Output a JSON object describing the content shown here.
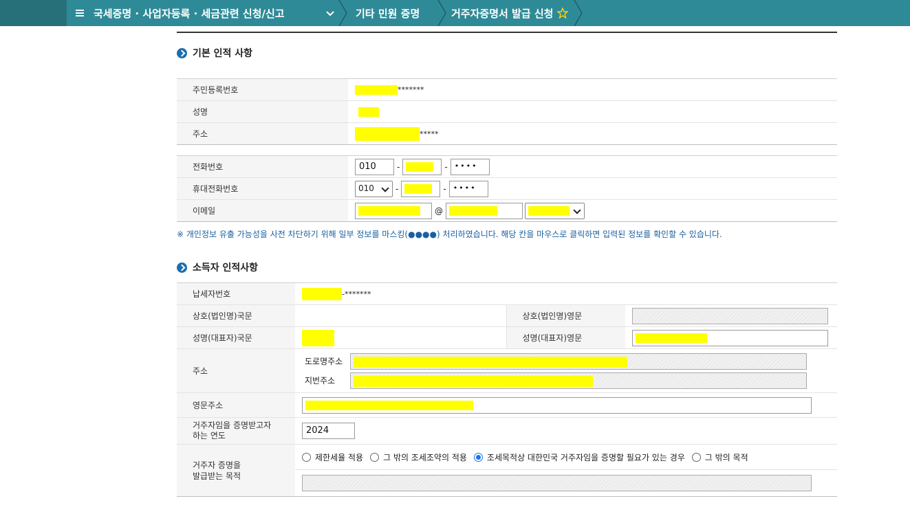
{
  "header": {
    "main_crumb": "국세증명 · 사업자등록 · 세금관련 신청/신고",
    "crumb_2": "기타 민원 증명",
    "crumb_3": "거주자증명서 발급 신청",
    "icons": [
      "menu-icon",
      "chevron-down-icon",
      "star-icon"
    ]
  },
  "basic_section": {
    "title": "기본 인적 사항",
    "rows": {
      "rrn_label": "주민등록번호",
      "rrn_suffix": "*******",
      "name_label": "성명",
      "address_label": "주소",
      "address_suffix": "*****"
    },
    "contact": {
      "phone_label": "전화번호",
      "phone_first": "010",
      "phone_last": "••••",
      "mobile_label": "휴대전화번호",
      "mobile_first": "010",
      "mobile_last": "••••",
      "email_label": "이메일",
      "email_at": "@"
    }
  },
  "notice": "※ 개인정보 유출 가능성을 사전 차단하기 위해 일부 정보를 마스킹(●●●●) 처리하였습니다. 해당 칸을 마우스로 클릭하면 입력된 정보를 확인할 수 있습니다.",
  "income_section": {
    "title": "소득자 인적사항",
    "tin_label": "납세자번호",
    "tin_suffix": "-*******",
    "biz_kr_label": "상호(법인명)국문",
    "biz_en_label": "상호(법인명)영문",
    "rep_kr_label": "성명(대표자)국문",
    "rep_en_label": "성명(대표자)영문",
    "addr_label": "주소",
    "road_addr_label": "도로명주소",
    "lot_addr_label": "지번주소",
    "en_addr_label": "영문주소",
    "year_label_1": "거주자임을 증명받고자",
    "year_label_2": "하는 연도",
    "year_value": "2024",
    "purpose_label_1": "거주자 증명을",
    "purpose_label_2": "발급받는 목적",
    "purpose_options": [
      "제한세율 적용",
      "그 밖의 조세조약의 적용",
      "조세목적상 대한민국 거주자임을 증명할 필요가 있는 경우",
      "그 밖의 목적"
    ],
    "purpose_selected": 2
  },
  "colors": {
    "topbar": "#2f8a97",
    "topbar_dark": "#27707a",
    "mask": "#ffff00",
    "notice": "#1a5fa0",
    "bullet": "#1a6fb0"
  }
}
